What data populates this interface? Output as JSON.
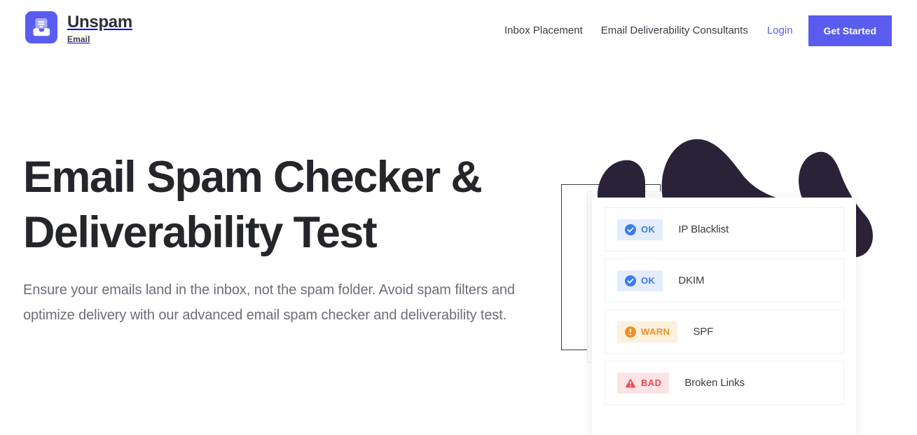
{
  "header": {
    "brand": {
      "name": "Unspam",
      "subtitle": "Email",
      "logo_icon": "inbox-tray-icon",
      "brand_color": "#5a5cf0"
    },
    "nav": [
      {
        "label": "Inbox Placement",
        "style": "plain"
      },
      {
        "label": "Email Deliverability Consultants",
        "style": "plain"
      },
      {
        "label": "Login",
        "style": "accent"
      }
    ],
    "cta": {
      "label": "Get Started",
      "bg": "#5a5cf0",
      "color": "#ffffff"
    }
  },
  "hero": {
    "title": "Email Spam Checker & Deliverability Test",
    "subtitle": "Ensure your emails land in the inbox, not the spam folder. Avoid spam filters and optimize delivery with our advanced email spam checker and deliverability test.",
    "title_color": "#25262b",
    "subtitle_color": "#6c6d77"
  },
  "results_card": {
    "rows": [
      {
        "status": "OK",
        "status_icon": "check-circle-icon",
        "label": "IP Blacklist",
        "badge_bg": "#e3edfe",
        "badge_fg": "#3b7cf0"
      },
      {
        "status": "OK",
        "status_icon": "check-circle-icon",
        "label": "DKIM",
        "badge_bg": "#e3edfe",
        "badge_fg": "#3b7cf0"
      },
      {
        "status": "WARN",
        "status_icon": "exclamation-circle-icon",
        "label": "SPF",
        "badge_bg": "#fdf0dd",
        "badge_fg": "#ef8f2a"
      },
      {
        "status": "BAD",
        "status_icon": "warning-triangle-icon",
        "label": "Broken Links",
        "badge_bg": "#fde3e5",
        "badge_fg": "#ec4a52"
      }
    ]
  },
  "decoration": {
    "blob_color": "#2a2338",
    "ghost_rect_border": "#3a3a48"
  }
}
